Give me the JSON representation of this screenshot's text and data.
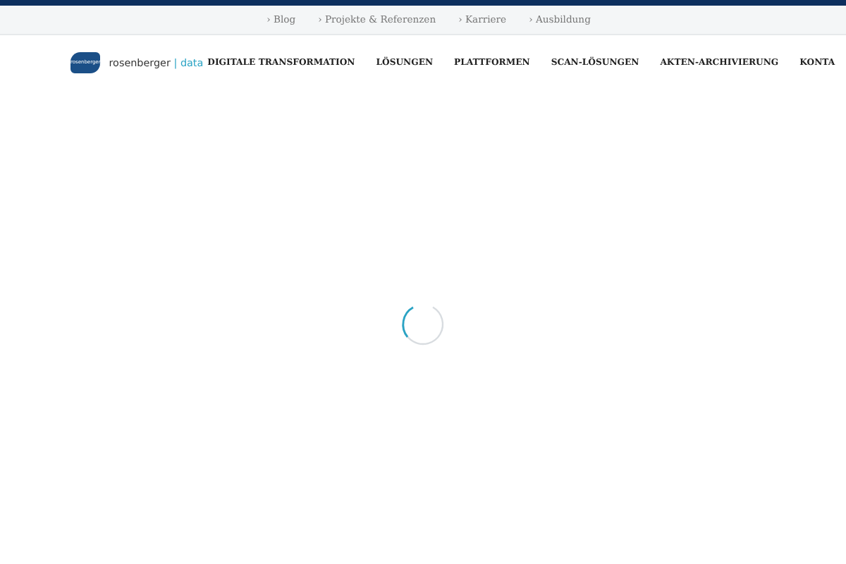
{
  "top_links": [
    {
      "label": "Blog"
    },
    {
      "label": "Projekte & Referenzen"
    },
    {
      "label": "Karriere"
    },
    {
      "label": "Ausbildung"
    }
  ],
  "link_marker": "›",
  "logo": {
    "badge": "rosenberger",
    "name": "rosenberger",
    "separator": "|",
    "suffix": "data"
  },
  "nav": [
    {
      "label": "DIGITALE TRANSFORMATION"
    },
    {
      "label": "LÖSUNGEN"
    },
    {
      "label": "PLATTFORMEN"
    },
    {
      "label": "SCAN-LÖSUNGEN"
    },
    {
      "label": "AKTEN-ARCHIVIERUNG"
    },
    {
      "label": "KONTA"
    }
  ]
}
